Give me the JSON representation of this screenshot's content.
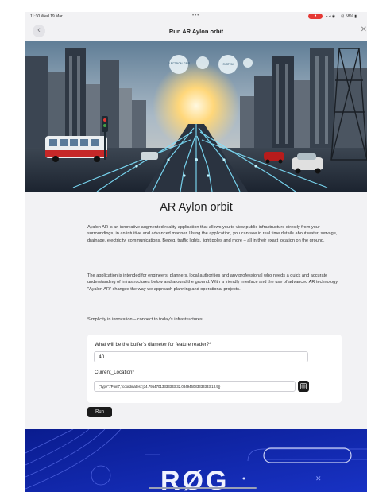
{
  "status_bar": {
    "time": "11:30  Wed 19 Mar",
    "dots": "•••",
    "system_icons": "⁎ ◂ ◉ ⊥ ⊡ 58% ▮"
  },
  "nav": {
    "back_icon": "chevron-left-icon",
    "title": "Run AR Aylon orbit",
    "close_icon": "close-icon"
  },
  "hero": {
    "signs": [
      "ELECTRICAL GRID",
      "SYSTEM"
    ]
  },
  "app": {
    "heading": "AR Aylon orbit",
    "paragraphs": [
      "Ayalon AR is an innovative augmented reality application that allows you to view public infrastructure directly from your surroundings, in an intuitive and advanced manner. Using the application, you can see in real time details about water, sewage, drainage, electricity, communications, Bezeq, traffic lights, light poles and more – all in their exact location on the ground.",
      "The application is intended for engineers, planners, local authorities and any professional who needs a quick and accurate understanding of infrastructures below and around the ground. With a friendly interface and the use of advanced AR technology, \"Ayalon AR\" changes the way we approach planning and operational projects.",
      "Simplicity in innovation – connect to today's infrastructures!"
    ]
  },
  "form": {
    "buffer_label": "What will be the buffer's diameter for feature reader?*",
    "buffer_value": "40",
    "location_label": "Current_Location*",
    "location_value": "{\"type\":\"Point\",\"coordinates\":[34.79547013333333,32.084946083333333,13.9]}",
    "map_icon": "map-picker-icon",
    "run_label": "Run"
  },
  "banner": {
    "text": "RØG"
  },
  "colors": {
    "banner_blue": "#0b1f9a",
    "button_dark": "#1b1b1b",
    "record_red": "#e53935",
    "page_bg": "#f2f2f4"
  }
}
